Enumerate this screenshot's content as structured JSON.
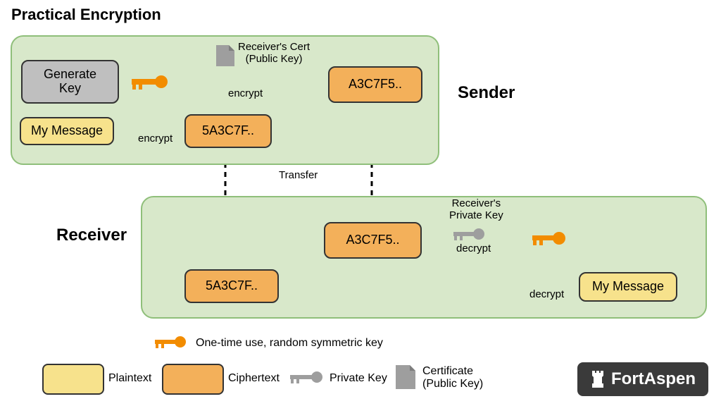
{
  "title": "Practical Encryption",
  "sender_label": "Sender",
  "receiver_label": "Receiver",
  "nodes": {
    "generate_key": "Generate\nKey",
    "my_message_src": "My Message",
    "cipher_msg_src": "5A3C7F..",
    "cipher_key_src": "A3C7F5..",
    "cipher_key_dst": "A3C7F5..",
    "cipher_msg_dst": "5A3C7F..",
    "my_message_dst": "My Message"
  },
  "labels": {
    "receivers_cert": "Receiver's Cert\n(Public Key)",
    "encrypt1": "encrypt",
    "encrypt2": "encrypt",
    "transfer": "Transfer",
    "receivers_priv": "Receiver's\nPrivate Key",
    "decrypt1": "decrypt",
    "decrypt2": "decrypt"
  },
  "legend": {
    "sym_key": "One-time use, random symmetric key",
    "plaintext": "Plaintext",
    "ciphertext": "Ciphertext",
    "private_key": "Private Key",
    "certificate": "Certificate\n(Public Key)",
    "brand": "FortAspen"
  }
}
